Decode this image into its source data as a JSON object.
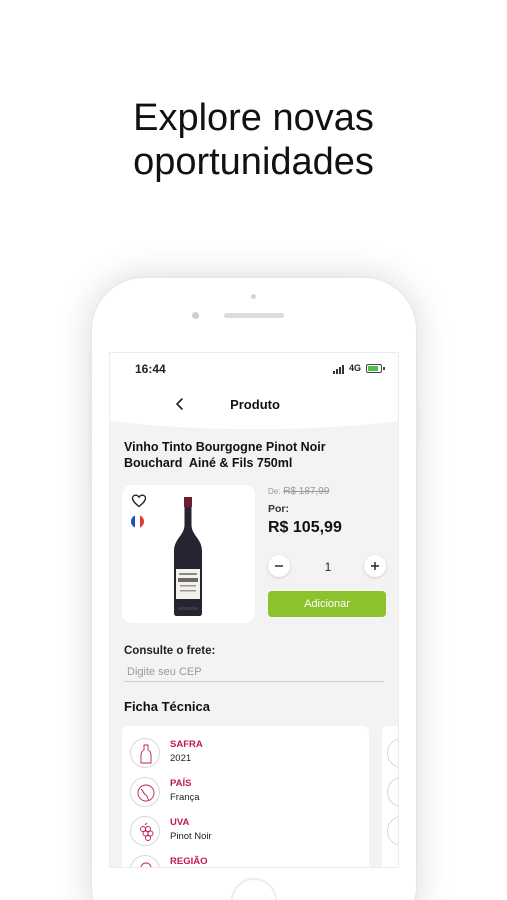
{
  "headline": {
    "line1": "Explore novas",
    "line2": "oportunidades"
  },
  "status_bar": {
    "time": "16:44",
    "network": "4G"
  },
  "header": {
    "title": "Produto",
    "back_icon": "chevron-left-icon"
  },
  "product": {
    "title_line1": "Vinho Tinto Bourgogne Pinot Noir",
    "title_line2": "Bouchard  Ainé & Fils 750ml",
    "old_price_prefix": "De:",
    "old_price": "R$ 187,99",
    "price_prefix": "Por:",
    "price": "R$ 105,99",
    "quantity": "1",
    "add_label": "Adicionar",
    "country_flag": "france-flag-icon"
  },
  "shipping": {
    "label": "Consulte o frete:",
    "placeholder": "Digite seu CEP"
  },
  "ficha": {
    "title": "Ficha Técnica",
    "items": [
      {
        "label": "SAFRA",
        "value": "2021",
        "icon": "bottle-icon"
      },
      {
        "label": "PAÍS",
        "value": "França",
        "icon": "globe-icon"
      },
      {
        "label": "UVA",
        "value": "Pinot Noir",
        "icon": "grape-icon"
      },
      {
        "label": "REGIÃO",
        "value": "",
        "icon": "map-pin-icon"
      }
    ]
  },
  "colors": {
    "accent_green": "#8cc22b",
    "label_magenta": "#c2185b",
    "screen_bg": "#f3f3f3"
  }
}
